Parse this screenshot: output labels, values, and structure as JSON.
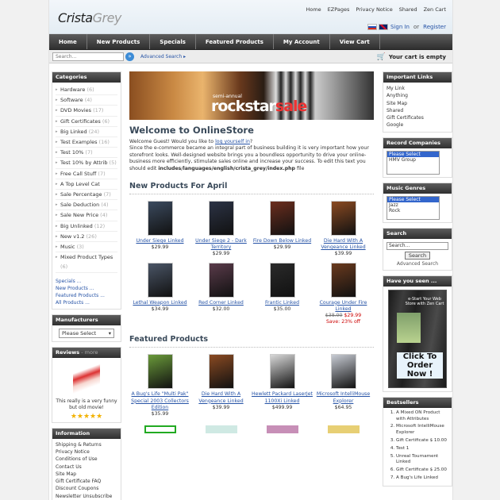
{
  "header": {
    "logo_main": "Crista",
    "logo_sub": "Grey",
    "top_links": [
      "Home",
      "EZPages",
      "Privacy Notice",
      "Shared",
      "Zen Cart"
    ],
    "account": {
      "signin": "Sign In",
      "or": "or",
      "register": "Register"
    }
  },
  "nav": [
    "Home",
    "New Products",
    "Specials",
    "Featured Products",
    "My Account",
    "View Cart"
  ],
  "search": {
    "placeholder": "Search...",
    "go": "»",
    "advanced": "Advanced Search ▸"
  },
  "cart": {
    "label": "Your cart is empty",
    "icon": "cart-icon"
  },
  "categories": {
    "title": "Categories",
    "items": [
      {
        "name": "Hardware",
        "count": "(6)"
      },
      {
        "name": "Software",
        "count": "(4)"
      },
      {
        "name": "DVD Movies",
        "count": "(17)"
      },
      {
        "name": "Gift Certificates",
        "count": "(6)"
      },
      {
        "name": "Big Linked",
        "count": "(24)"
      },
      {
        "name": "Test Examples",
        "count": "(16)"
      },
      {
        "name": "Test 10%",
        "count": "(7)"
      },
      {
        "name": "Test 10% by Attrib",
        "count": "(5)"
      },
      {
        "name": "Free Call Stuff",
        "count": "(7)"
      },
      {
        "name": "A Top Level Cat",
        "count": ""
      },
      {
        "name": "Sale Percentage",
        "count": "(7)"
      },
      {
        "name": "Sale Deduction",
        "count": "(4)"
      },
      {
        "name": "Sale New Price",
        "count": "(4)"
      },
      {
        "name": "Big Unlinked",
        "count": "(12)"
      },
      {
        "name": "New v1.2",
        "count": "(26)"
      },
      {
        "name": "Music",
        "count": "(3)"
      },
      {
        "name": "Mixed Product Types",
        "count": "(6)"
      }
    ],
    "links": [
      "Specials ...",
      "New Products ...",
      "Featured Products ...",
      "All Products ..."
    ]
  },
  "manufacturers": {
    "title": "Manufacturers",
    "selected": "Please Select"
  },
  "reviews": {
    "title": "Reviews",
    "more": " - more",
    "text": "This really is a very funny but old movie!",
    "stars": "★★★★★"
  },
  "information": {
    "title": "Information",
    "items": [
      "Shipping & Returns",
      "Privacy Notice",
      "Conditions of Use",
      "Contact Us",
      "Site Map",
      "Gift Certificate FAQ",
      "Discount Coupons",
      "Newsletter Unsubscribe"
    ]
  },
  "banner": {
    "semi": "semi-annual",
    "rock": "rockstar",
    "sale": "sale"
  },
  "welcome": {
    "title": "Welcome to OnlineStore",
    "greeting": "Welcome Guest! Would you like to ",
    "login": "log yourself in",
    "q": "?",
    "body": "Since the e-commerce became an integral part of business building it is very important how your storefront looks. Well-designed website brings you a boundless opportunity to drive your online-business more efficiently, stimulate sales online and increase your success. To edit this text you should edit ",
    "path": "includes/languages/english/crista_grey/index.php",
    "tail": " file"
  },
  "new_products": {
    "title": "New Products For April",
    "items": [
      {
        "name": "Under Siege Linked",
        "price": "$29.99",
        "old": "",
        "sale": "",
        "save": "",
        "color": "#3b4a5e"
      },
      {
        "name": "Under Siege 2 - Dark Territory",
        "price": "$29.99",
        "old": "",
        "sale": "",
        "save": "",
        "color": "#2c3345"
      },
      {
        "name": "Fire Down Below Linked",
        "price": "$29.99",
        "old": "",
        "sale": "",
        "save": "",
        "color": "#6b2e1e"
      },
      {
        "name": "Die Hard With A Vengeance Linked",
        "price": "$39.99",
        "old": "",
        "sale": "",
        "save": "",
        "color": "#8a4a22"
      },
      {
        "name": "Lethal Weapon Linked",
        "price": "$34.99",
        "old": "",
        "sale": "",
        "save": "",
        "color": "#4a5566"
      },
      {
        "name": "Red Corner Linked",
        "price": "$32.00",
        "old": "",
        "sale": "",
        "save": "",
        "color": "#5a3b4a"
      },
      {
        "name": "Frantic Linked",
        "price": "$35.00",
        "old": "",
        "sale": "",
        "save": "",
        "color": "#2a2a2a"
      },
      {
        "name": "Courage Under Fire Linked",
        "price": "",
        "old": "$38.99",
        "sale": "$29.99",
        "save": "Save: 23% off",
        "color": "#6a3a1e"
      }
    ]
  },
  "featured": {
    "title": "Featured Products",
    "items": [
      {
        "name": "A Bug's Life \"Multi Pak\" Special 2003 Collectors Edition",
        "price": "$35.99",
        "color": "#6a9a3a"
      },
      {
        "name": "Die Hard With A Vengeance Linked",
        "price": "$39.99",
        "color": "#8a4a22"
      },
      {
        "name": "Hewlett Packard LaserJet 1100Xi Linked",
        "price": "$499.99",
        "color": "#d8d8d8"
      },
      {
        "name": "Microsoft IntelliMouse Explorer",
        "price": "$64.95",
        "color": "#c8ccd4"
      }
    ]
  },
  "important_links": {
    "title": "Important Links",
    "items": [
      "My Link",
      "Anything",
      "Site Map",
      "Shared",
      "Gift Certificates",
      "Google"
    ]
  },
  "record_companies": {
    "title": "Record Companies",
    "options": [
      "Please Select",
      "HMV Group"
    ]
  },
  "music_genres": {
    "title": "Music Genres",
    "options": [
      "Please Select",
      "Jazz",
      "Rock"
    ]
  },
  "rsearch": {
    "title": "Search",
    "value": "Search...",
    "button": "Search",
    "advanced": "Advanced Search"
  },
  "have_seen": {
    "title": "Have you seen ...",
    "box_title": "e-Start Your Web Store with Zen Cart",
    "cta": "Click To Order Now !"
  },
  "bestsellers": {
    "title": "Bestsellers",
    "items": [
      "A Mixed ON Product with Attributes",
      "Microsoft IntelliMouse Explorer",
      "Gift Certificate $ 10.00",
      "Test 1",
      "Unreal Tournament Linked",
      "Gift Certificate $ 25.00",
      "A Bug's Life Linked"
    ]
  }
}
